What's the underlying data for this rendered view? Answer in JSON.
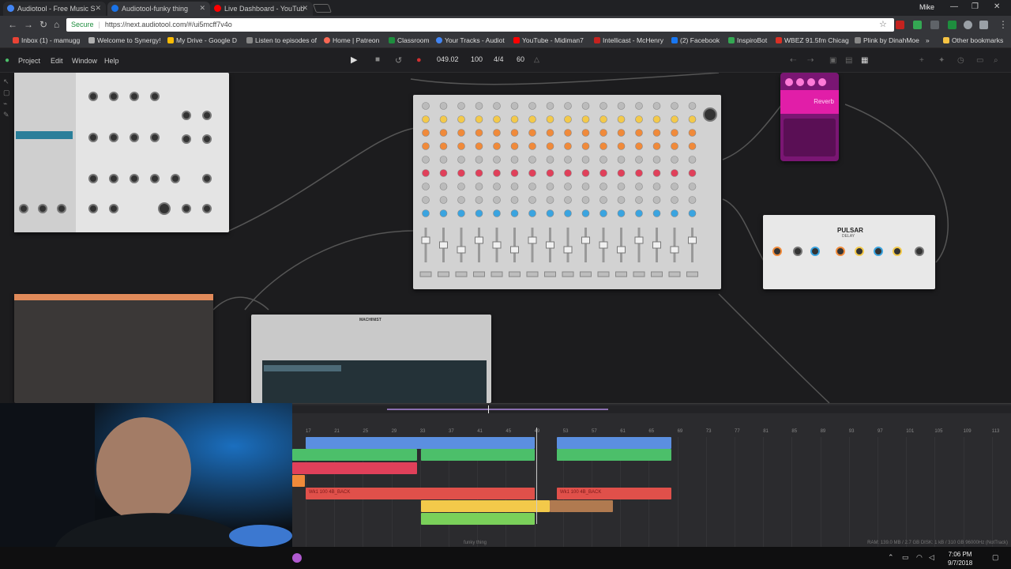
{
  "browser": {
    "tabs": [
      {
        "title": "Audiotool - Free Music S",
        "favicon_color": "#4285f4"
      },
      {
        "title": "Audiotool-funky thing",
        "favicon_color": "#1a73e8"
      },
      {
        "title": "Live Dashboard - YouTub",
        "favicon_color": "#ff0000"
      }
    ],
    "user": "Mike",
    "secure_label": "Secure",
    "url": "https://next.audiotool.com/#/ui5mcff7v4o",
    "bookmarks": [
      "Inbox (1) - mamugg",
      "Welcome to Synergy!",
      "My Drive - Google D",
      "Listen to episodes of",
      "Home | Patreon",
      "Classroom",
      "Your Tracks - Audiot",
      "YouTube - Midiman7",
      "Intellicast - McHenry",
      "(2) Facebook",
      "InspiroBot",
      "WBEZ 91.5fm Chicag",
      "Plink by DinahMoe"
    ],
    "other_bookmarks": "Other bookmarks"
  },
  "app": {
    "menu": [
      "Project",
      "Edit",
      "Window",
      "Help"
    ],
    "transport": {
      "position": "049.02",
      "tempo": "100",
      "signature": "4/4",
      "value": "60"
    }
  },
  "devices": {
    "reverb_label": "Reverb",
    "pulsar_label": "PULSAR",
    "pulsar_sub": "DELAY",
    "machiniste_label": "MACHINIST"
  },
  "timeline": {
    "ruler": [
      "17",
      "21",
      "25",
      "29",
      "33",
      "37",
      "41",
      "45",
      "49",
      "53",
      "57",
      "61",
      "65",
      "69",
      "73",
      "77",
      "81",
      "85",
      "89",
      "93",
      "97",
      "101",
      "105",
      "109",
      "113"
    ],
    "clip_label": "Wk1 100 4B_BACK",
    "project_name": "funky thing",
    "status": "RAM: 139.0 MB / 2.7 GB  DISK: 1 kB / 310 GB  96000Hz (NotTrack)"
  },
  "taskbar": {
    "time": "7:06 PM",
    "date": "9/7/2018"
  },
  "colors": {
    "accent_blue": "#5b8fe0",
    "accent_green": "#4cbf6a",
    "accent_red": "#e0504a",
    "accent_yellow": "#f3c94a",
    "accent_orange": "#f08a3a",
    "accent_pink": "#ff4fd1"
  }
}
